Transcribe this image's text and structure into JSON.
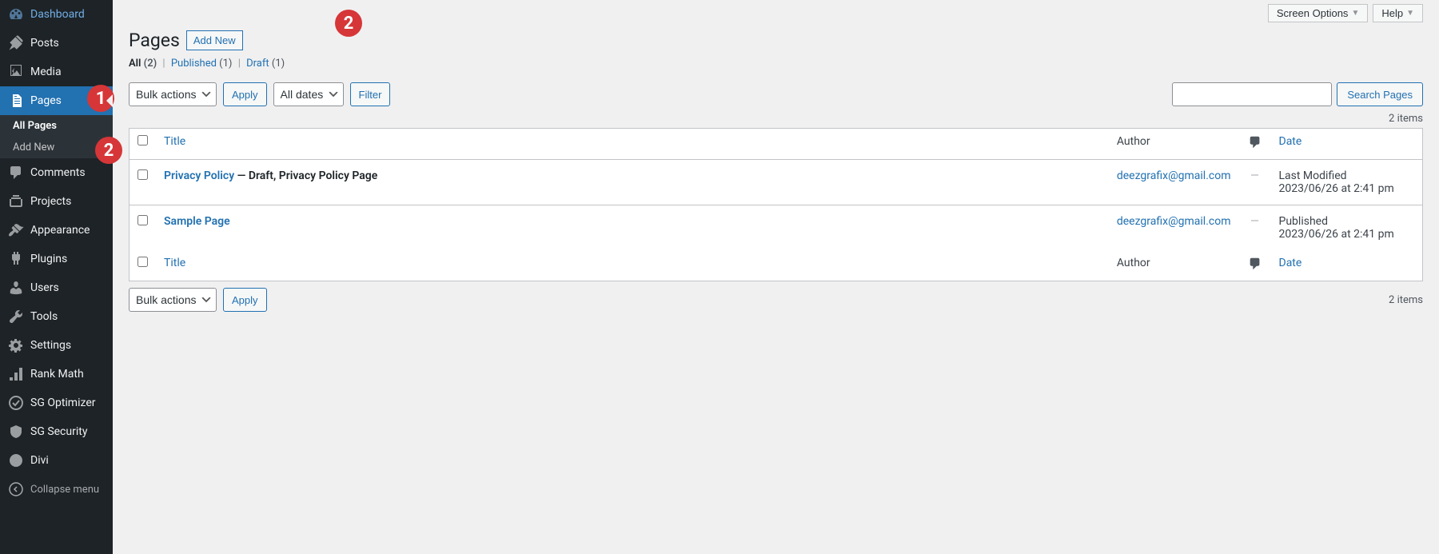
{
  "sidebar": {
    "items": [
      {
        "label": "Dashboard",
        "icon": "dashboard"
      },
      {
        "label": "Posts",
        "icon": "pin"
      },
      {
        "label": "Media",
        "icon": "media"
      },
      {
        "label": "Pages",
        "icon": "page",
        "active": true,
        "badge": "1"
      },
      {
        "label": "Comments",
        "icon": "comment"
      },
      {
        "label": "Projects",
        "icon": "portfolio"
      },
      {
        "label": "Appearance",
        "icon": "brush"
      },
      {
        "label": "Plugins",
        "icon": "plugin"
      },
      {
        "label": "Users",
        "icon": "user"
      },
      {
        "label": "Tools",
        "icon": "tools"
      },
      {
        "label": "Settings",
        "icon": "settings"
      },
      {
        "label": "Rank Math",
        "icon": "rankmath"
      },
      {
        "label": "SG Optimizer",
        "icon": "sg"
      },
      {
        "label": "SG Security",
        "icon": "sg-sec"
      },
      {
        "label": "Divi",
        "icon": "divi"
      }
    ],
    "submenu": [
      {
        "label": "All Pages",
        "active": true
      },
      {
        "label": "Add New",
        "badge": "2"
      }
    ],
    "collapse": "Collapse menu"
  },
  "topbar": {
    "screen_options": "Screen Options",
    "help": "Help"
  },
  "header": {
    "title": "Pages",
    "add_new": "Add New",
    "badge": "2"
  },
  "filters": {
    "all_label": "All",
    "all_count": "(2)",
    "published_label": "Published",
    "published_count": "(1)",
    "draft_label": "Draft",
    "draft_count": "(1)"
  },
  "controls": {
    "bulk_actions": "Bulk actions",
    "apply": "Apply",
    "all_dates": "All dates",
    "filter": "Filter",
    "search_btn": "Search Pages",
    "items_count": "2 items"
  },
  "table": {
    "headers": {
      "title": "Title",
      "author": "Author",
      "date": "Date"
    },
    "rows": [
      {
        "title": "Privacy Policy",
        "state": " — Draft, Privacy Policy Page",
        "author": "deezgrafix@gmail.com",
        "comments": "—",
        "date_label": "Last Modified",
        "date_value": "2023/06/26 at 2:41 pm"
      },
      {
        "title": "Sample Page",
        "state": "",
        "author": "deezgrafix@gmail.com",
        "comments": "—",
        "date_label": "Published",
        "date_value": "2023/06/26 at 2:41 pm"
      }
    ]
  }
}
